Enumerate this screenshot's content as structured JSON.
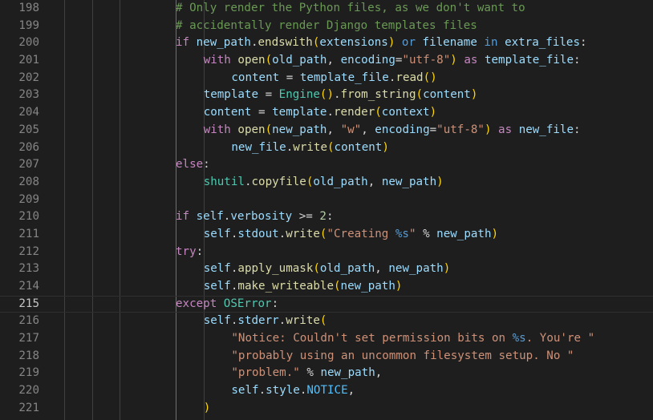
{
  "editor": {
    "language": "Python",
    "current_line": 215,
    "colors": {
      "background": "#1e1e1e",
      "line_number": "#858585",
      "line_number_active": "#c6c6c6",
      "variable": "#9cdcfe",
      "keyword": "#c586c0",
      "function": "#dcdcaa",
      "class": "#4ec9b0",
      "string": "#ce9178",
      "number": "#b5cea8",
      "comment": "#6a9955",
      "bracket": "#ffd700"
    },
    "lines": [
      {
        "number": "198",
        "indent": 4,
        "tokens": [
          [
            "t-cm",
            "# Only render the Python files, as we don't want to"
          ]
        ]
      },
      {
        "number": "199",
        "indent": 4,
        "tokens": [
          [
            "t-cm",
            "# accidentally render Django templates files"
          ]
        ]
      },
      {
        "number": "200",
        "indent": 4,
        "tokens": [
          [
            "t-ctl",
            "if "
          ],
          [
            "t-plain",
            "new_path"
          ],
          [
            "t-pun",
            "."
          ],
          [
            "t-fn",
            "endswith"
          ],
          [
            "t-br",
            "("
          ],
          [
            "t-plain",
            "extensions"
          ],
          [
            "t-br",
            ")"
          ],
          [
            "t-bl",
            " or "
          ],
          [
            "t-plain",
            "filename"
          ],
          [
            "t-bl",
            " in "
          ],
          [
            "t-plain",
            "extra_files"
          ],
          [
            "t-pun",
            ":"
          ]
        ]
      },
      {
        "number": "201",
        "indent": 5,
        "tokens": [
          [
            "t-ctl",
            "with "
          ],
          [
            "t-fn",
            "open"
          ],
          [
            "t-br",
            "("
          ],
          [
            "t-plain",
            "old_path"
          ],
          [
            "t-pun",
            ", "
          ],
          [
            "t-plain",
            "encoding"
          ],
          [
            "t-op",
            "="
          ],
          [
            "t-str",
            "\"utf-8\""
          ],
          [
            "t-br",
            ")"
          ],
          [
            "t-ctl",
            " as "
          ],
          [
            "t-plain",
            "template_file"
          ],
          [
            "t-pun",
            ":"
          ]
        ]
      },
      {
        "number": "202",
        "indent": 6,
        "tokens": [
          [
            "t-plain",
            "content"
          ],
          [
            "t-op",
            " = "
          ],
          [
            "t-plain",
            "template_file"
          ],
          [
            "t-pun",
            "."
          ],
          [
            "t-fn",
            "read"
          ],
          [
            "t-br",
            "()"
          ]
        ]
      },
      {
        "number": "203",
        "indent": 5,
        "tokens": [
          [
            "t-plain",
            "template"
          ],
          [
            "t-op",
            " = "
          ],
          [
            "t-cls",
            "Engine"
          ],
          [
            "t-br",
            "()"
          ],
          [
            "t-pun",
            "."
          ],
          [
            "t-fn",
            "from_string"
          ],
          [
            "t-br",
            "("
          ],
          [
            "t-plain",
            "content"
          ],
          [
            "t-br",
            ")"
          ]
        ]
      },
      {
        "number": "204",
        "indent": 5,
        "tokens": [
          [
            "t-plain",
            "content"
          ],
          [
            "t-op",
            " = "
          ],
          [
            "t-plain",
            "template"
          ],
          [
            "t-pun",
            "."
          ],
          [
            "t-fn",
            "render"
          ],
          [
            "t-br",
            "("
          ],
          [
            "t-plain",
            "context"
          ],
          [
            "t-br",
            ")"
          ]
        ]
      },
      {
        "number": "205",
        "indent": 5,
        "tokens": [
          [
            "t-ctl",
            "with "
          ],
          [
            "t-fn",
            "open"
          ],
          [
            "t-br",
            "("
          ],
          [
            "t-plain",
            "new_path"
          ],
          [
            "t-pun",
            ", "
          ],
          [
            "t-str",
            "\"w\""
          ],
          [
            "t-pun",
            ", "
          ],
          [
            "t-plain",
            "encoding"
          ],
          [
            "t-op",
            "="
          ],
          [
            "t-str",
            "\"utf-8\""
          ],
          [
            "t-br",
            ")"
          ],
          [
            "t-ctl",
            " as "
          ],
          [
            "t-plain",
            "new_file"
          ],
          [
            "t-pun",
            ":"
          ]
        ]
      },
      {
        "number": "206",
        "indent": 6,
        "tokens": [
          [
            "t-plain",
            "new_file"
          ],
          [
            "t-pun",
            "."
          ],
          [
            "t-fn",
            "write"
          ],
          [
            "t-br",
            "("
          ],
          [
            "t-plain",
            "content"
          ],
          [
            "t-br",
            ")"
          ]
        ]
      },
      {
        "number": "207",
        "indent": 4,
        "tokens": [
          [
            "t-ctl",
            "else"
          ],
          [
            "t-pun",
            ":"
          ]
        ]
      },
      {
        "number": "208",
        "indent": 5,
        "tokens": [
          [
            "t-cls",
            "shutil"
          ],
          [
            "t-pun",
            "."
          ],
          [
            "t-fn",
            "copyfile"
          ],
          [
            "t-br",
            "("
          ],
          [
            "t-plain",
            "old_path"
          ],
          [
            "t-pun",
            ", "
          ],
          [
            "t-plain",
            "new_path"
          ],
          [
            "t-br",
            ")"
          ]
        ]
      },
      {
        "number": "209",
        "indent": 4,
        "tokens": []
      },
      {
        "number": "210",
        "indent": 4,
        "tokens": [
          [
            "t-ctl",
            "if "
          ],
          [
            "t-plain",
            "self"
          ],
          [
            "t-pun",
            "."
          ],
          [
            "t-plain",
            "verbosity"
          ],
          [
            "t-op",
            " >= "
          ],
          [
            "t-num",
            "2"
          ],
          [
            "t-pun",
            ":"
          ]
        ]
      },
      {
        "number": "211",
        "indent": 5,
        "tokens": [
          [
            "t-plain",
            "self"
          ],
          [
            "t-pun",
            "."
          ],
          [
            "t-plain",
            "stdout"
          ],
          [
            "t-pun",
            "."
          ],
          [
            "t-fn",
            "write"
          ],
          [
            "t-br",
            "("
          ],
          [
            "t-str",
            "\"Creating "
          ],
          [
            "t-esc",
            "%s"
          ],
          [
            "t-str",
            "\""
          ],
          [
            "t-op",
            " % "
          ],
          [
            "t-plain",
            "new_path"
          ],
          [
            "t-br",
            ")"
          ]
        ]
      },
      {
        "number": "212",
        "indent": 4,
        "tokens": [
          [
            "t-ctl",
            "try"
          ],
          [
            "t-pun",
            ":"
          ]
        ]
      },
      {
        "number": "213",
        "indent": 5,
        "tokens": [
          [
            "t-plain",
            "self"
          ],
          [
            "t-pun",
            "."
          ],
          [
            "t-fn",
            "apply_umask"
          ],
          [
            "t-br",
            "("
          ],
          [
            "t-plain",
            "old_path"
          ],
          [
            "t-pun",
            ", "
          ],
          [
            "t-plain",
            "new_path"
          ],
          [
            "t-br",
            ")"
          ]
        ]
      },
      {
        "number": "214",
        "indent": 5,
        "tokens": [
          [
            "t-plain",
            "self"
          ],
          [
            "t-pun",
            "."
          ],
          [
            "t-fn",
            "make_writeable"
          ],
          [
            "t-br",
            "("
          ],
          [
            "t-plain",
            "new_path"
          ],
          [
            "t-br",
            ")"
          ]
        ]
      },
      {
        "number": "215",
        "indent": 4,
        "tokens": [
          [
            "t-ctl",
            "except "
          ],
          [
            "t-cls",
            "OSError"
          ],
          [
            "t-pun",
            ":"
          ]
        ]
      },
      {
        "number": "216",
        "indent": 5,
        "tokens": [
          [
            "t-plain",
            "self"
          ],
          [
            "t-pun",
            "."
          ],
          [
            "t-plain",
            "stderr"
          ],
          [
            "t-pun",
            "."
          ],
          [
            "t-fn",
            "write"
          ],
          [
            "t-br",
            "("
          ]
        ]
      },
      {
        "number": "217",
        "indent": 6,
        "tokens": [
          [
            "t-str",
            "\"Notice: Couldn't set permission bits on "
          ],
          [
            "t-esc",
            "%s"
          ],
          [
            "t-str",
            ". You're \""
          ]
        ]
      },
      {
        "number": "218",
        "indent": 6,
        "tokens": [
          [
            "t-str",
            "\"probably using an uncommon filesystem setup. No \""
          ]
        ]
      },
      {
        "number": "219",
        "indent": 6,
        "tokens": [
          [
            "t-str",
            "\"problem.\""
          ],
          [
            "t-op",
            " % "
          ],
          [
            "t-plain",
            "new_path"
          ],
          [
            "t-pun",
            ","
          ]
        ]
      },
      {
        "number": "220",
        "indent": 6,
        "tokens": [
          [
            "t-plain",
            "self"
          ],
          [
            "t-pun",
            "."
          ],
          [
            "t-plain",
            "style"
          ],
          [
            "t-pun",
            "."
          ],
          [
            "t-const",
            "NOTICE"
          ],
          [
            "t-pun",
            ","
          ]
        ]
      },
      {
        "number": "221",
        "indent": 5,
        "tokens": [
          [
            "t-br",
            ")"
          ]
        ]
      }
    ]
  }
}
